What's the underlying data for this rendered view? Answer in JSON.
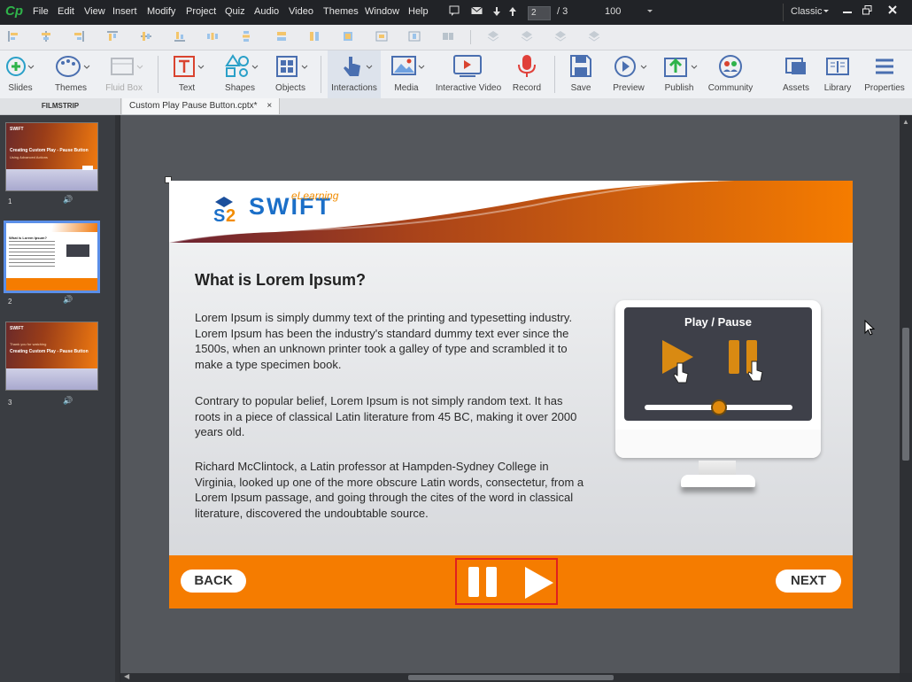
{
  "app": {
    "logo": "Cp",
    "theme_mode": "Classic"
  },
  "menus": [
    "File",
    "Edit",
    "View",
    "Insert",
    "Modify",
    "Project",
    "Quiz",
    "Audio",
    "Video",
    "Themes",
    "Window",
    "Help"
  ],
  "nav": {
    "current_slide": "2",
    "total_label": "/ 3",
    "zoom": "100"
  },
  "ribbon": [
    {
      "label": "Slides",
      "icon": "slides-icon"
    },
    {
      "label": "Themes",
      "icon": "palette-icon"
    },
    {
      "label": "Fluid Box",
      "icon": "fluidbox-icon"
    },
    {
      "label": "Text",
      "icon": "text-icon"
    },
    {
      "label": "Shapes",
      "icon": "shapes-icon"
    },
    {
      "label": "Objects",
      "icon": "objects-icon"
    },
    {
      "label": "Interactions",
      "icon": "interactions-icon"
    },
    {
      "label": "Media",
      "icon": "media-icon"
    },
    {
      "label": "Interactive Video",
      "icon": "interactive-video-icon"
    },
    {
      "label": "Record",
      "icon": "record-icon"
    },
    {
      "label": "Save",
      "icon": "save-icon"
    },
    {
      "label": "Preview",
      "icon": "preview-icon"
    },
    {
      "label": "Publish",
      "icon": "publish-icon"
    },
    {
      "label": "Community",
      "icon": "community-icon"
    },
    {
      "label": "Assets",
      "icon": "assets-icon"
    },
    {
      "label": "Library",
      "icon": "library-icon"
    },
    {
      "label": "Properties",
      "icon": "properties-icon"
    }
  ],
  "panels": {
    "filmstrip_title": "FILMSTRIP",
    "doc_tab": "Custom Play Pause Button.cptx*",
    "doc_tab_close": "×"
  },
  "filmstrip": [
    {
      "num": "1",
      "title": "Creating Custom Play - Pause Button",
      "subtitle": "Using Advanced Actions"
    },
    {
      "num": "2",
      "title": "What is Lorem Ipsum?",
      "subtitle": ""
    },
    {
      "num": "3",
      "title": "Creating Custom Play - Pause Button",
      "subtitle": "Thank you for watching"
    }
  ],
  "slide": {
    "logo_text": "SWIFT",
    "logo_sub": "eLearning",
    "heading": "What is Lorem Ipsum?",
    "paragraphs": [
      "Lorem Ipsum is simply dummy text of the printing and typesetting industry. Lorem Ipsum has been the industry's standard dummy text ever since the 1500s, when an unknown printer took a galley of type and scrambled it to make a type specimen book.",
      "Contrary to popular belief, Lorem Ipsum is not simply random text. It has roots in a piece of classical Latin literature from 45 BC, making it over 2000 years old.",
      "Richard McClintock, a Latin professor at Hampden-Sydney College in Virginia, looked up one of the more obscure Latin words, consectetur, from a Lorem Ipsum passage, and going through the cites of the word in classical literature, discovered the undoubtable source."
    ],
    "monitor_title": "Play / Pause",
    "slider_level": 0.5,
    "back_label": "BACK",
    "next_label": "NEXT"
  },
  "colors": {
    "accent_orange": "#f57c00",
    "selection_red": "#e02020",
    "thumb_select": "#5b8fe8"
  }
}
